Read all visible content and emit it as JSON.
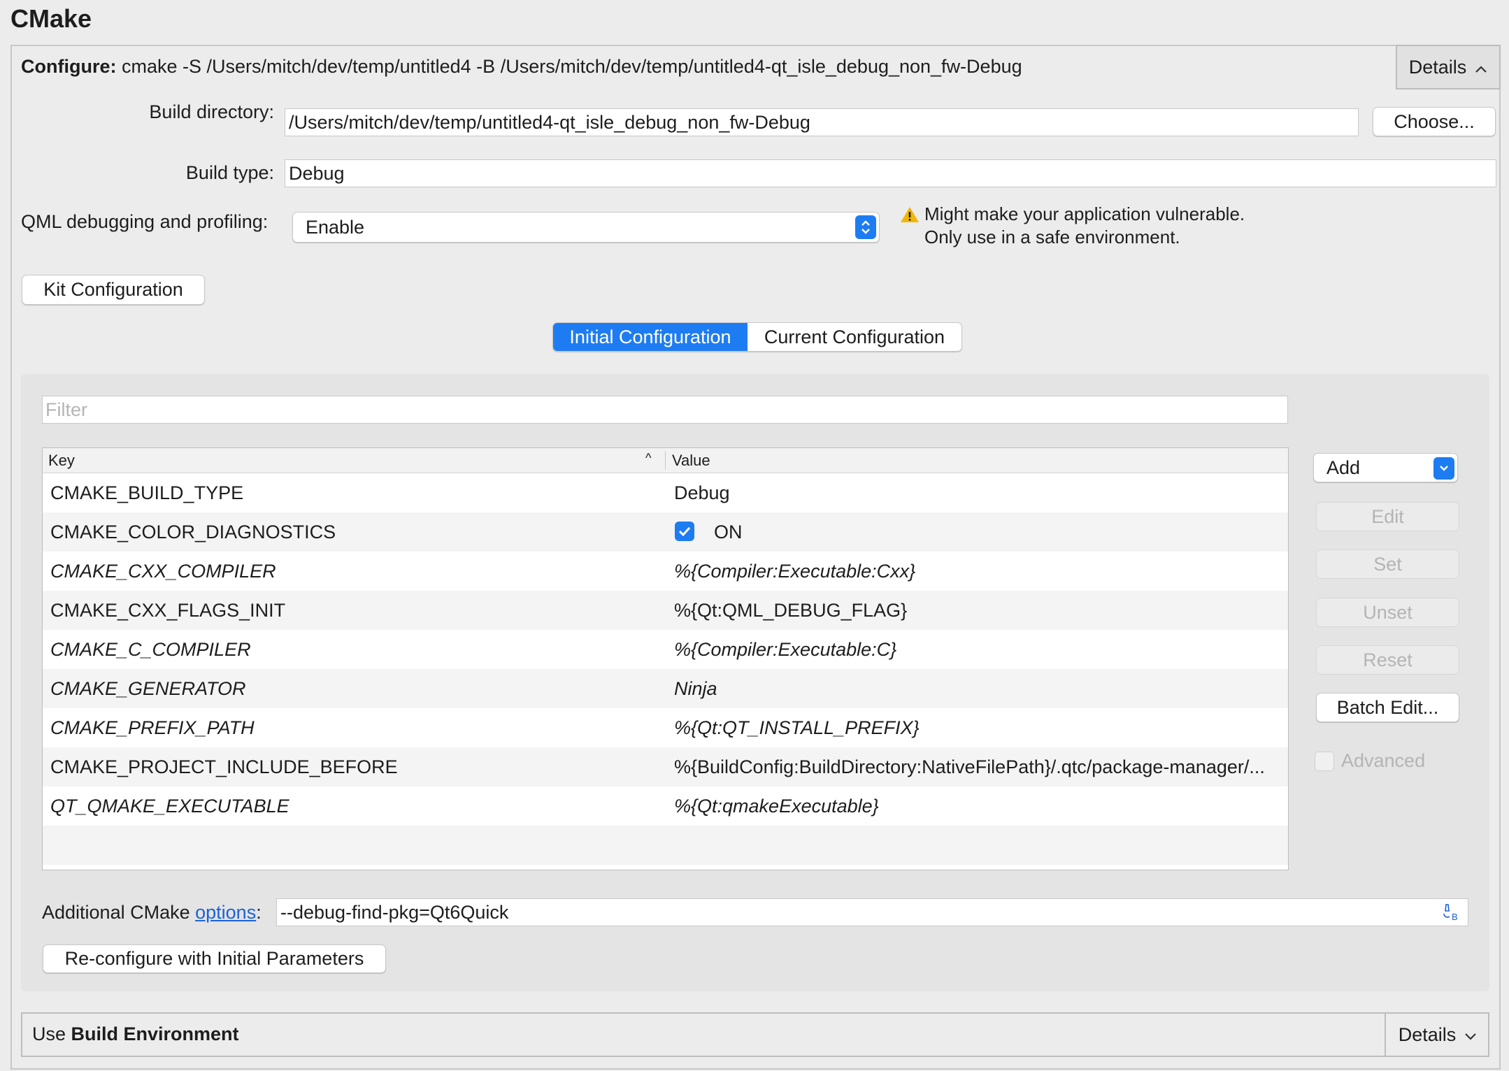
{
  "section_title": "CMake",
  "configure": {
    "label": "Configure:",
    "command": "cmake -S /Users/mitch/dev/temp/untitled4 -B /Users/mitch/dev/temp/untitled4-qt_isle_debug_non_fw-Debug",
    "details_label": "Details"
  },
  "build_directory": {
    "label": "Build directory:",
    "value": "/Users/mitch/dev/temp/untitled4-qt_isle_debug_non_fw-Debug",
    "choose_label": "Choose..."
  },
  "build_type": {
    "label": "Build type:",
    "value": "Debug"
  },
  "qml_debugging": {
    "label": "QML debugging and profiling:",
    "selected": "Enable",
    "warning_line1": "Might make your application vulnerable.",
    "warning_line2": "Only use in a safe environment."
  },
  "kit_configuration_label": "Kit Configuration",
  "config_tabs": {
    "initial": "Initial Configuration",
    "current": "Current Configuration",
    "active": "Initial Configuration"
  },
  "filter_placeholder": "Filter",
  "table": {
    "columns": [
      "Key",
      "Value"
    ],
    "rows": [
      {
        "key": "CMAKE_BUILD_TYPE",
        "value": "Debug"
      },
      {
        "key": "CMAKE_COLOR_DIAGNOSTICS",
        "value": "ON",
        "checked": true
      },
      {
        "key": "CMAKE_CXX_COMPILER",
        "value": "%{Compiler:Executable:Cxx}"
      },
      {
        "key": "CMAKE_CXX_FLAGS_INIT",
        "value": "%{Qt:QML_DEBUG_FLAG}"
      },
      {
        "key": "CMAKE_C_COMPILER",
        "value": "%{Compiler:Executable:C}"
      },
      {
        "key": "CMAKE_GENERATOR",
        "value": "Ninja"
      },
      {
        "key": "CMAKE_PREFIX_PATH",
        "value": "%{Qt:QT_INSTALL_PREFIX}"
      },
      {
        "key": "CMAKE_PROJECT_INCLUDE_BEFORE",
        "value": "%{BuildConfig:BuildDirectory:NativeFilePath}/.qtc/package-manager/..."
      },
      {
        "key": "QT_QMAKE_EXECUTABLE",
        "value": "%{Qt:qmakeExecutable}"
      }
    ]
  },
  "side_buttons": {
    "add": "Add",
    "edit": "Edit",
    "set": "Set",
    "unset": "Unset",
    "reset": "Reset",
    "batch_edit": "Batch Edit...",
    "advanced": "Advanced"
  },
  "additional_options": {
    "label_prefix": "Additional CMake ",
    "link": "options",
    "label_suffix": ":",
    "value": "--debug-find-pkg=Qt6Quick"
  },
  "reconfigure_label": "Re-configure with Initial Parameters",
  "build_environment": {
    "prefix": "Use ",
    "bold": "Build Environment",
    "details_label": "Details"
  },
  "colors": {
    "accent": "#1e7cf2",
    "link": "#1b62d8",
    "warning": "#f2b705"
  }
}
